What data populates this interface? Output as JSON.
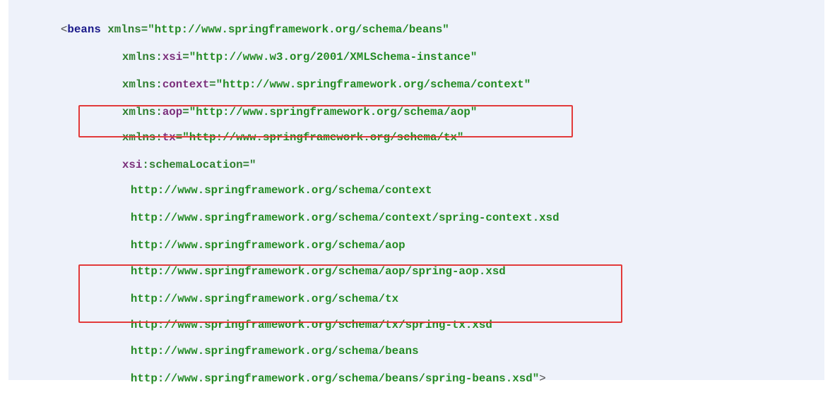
{
  "code": {
    "root_tag_open": "<",
    "root_tag_name": "beans",
    "lines": [
      {
        "attr": "xmlns",
        "prefix": "",
        "value": "\"http://www.springframework.org/schema/beans\""
      },
      {
        "attr": "xmlns:",
        "prefix": "xsi",
        "value": "\"http://www.w3.org/2001/XMLSchema-instance\""
      },
      {
        "attr": "xmlns:",
        "prefix": "context",
        "value": "\"http://www.springframework.org/schema/context\""
      },
      {
        "attr": "xmlns:",
        "prefix": "aop",
        "value": "\"http://www.springframework.org/schema/aop\""
      },
      {
        "attr": "xmlns:",
        "prefix": "tx",
        "value": "\"http://www.springframework.org/schema/tx\""
      }
    ],
    "schema_location_prefix": "xsi",
    "schema_location_attr": ":schemaLocation",
    "schema_location_open": "=\"",
    "uris": [
      "http://www.springframework.org/schema/context",
      "http://www.springframework.org/schema/context/spring-context.xsd",
      "http://www.springframework.org/schema/aop",
      "http://www.springframework.org/schema/aop/spring-aop.xsd",
      "http://www.springframework.org/schema/tx",
      "http://www.springframework.org/schema/tx/spring-tx.xsd",
      "http://www.springframework.org/schema/beans",
      "http://www.springframework.org/schema/beans/spring-beans.xsd"
    ],
    "closing_quote": "\"",
    "closing_bracket": ">",
    "equals": "="
  },
  "colors": {
    "background": "#eef2fa",
    "highlight": "#e23a3a",
    "string": "#238a23",
    "prefix": "#7b2f7b"
  }
}
